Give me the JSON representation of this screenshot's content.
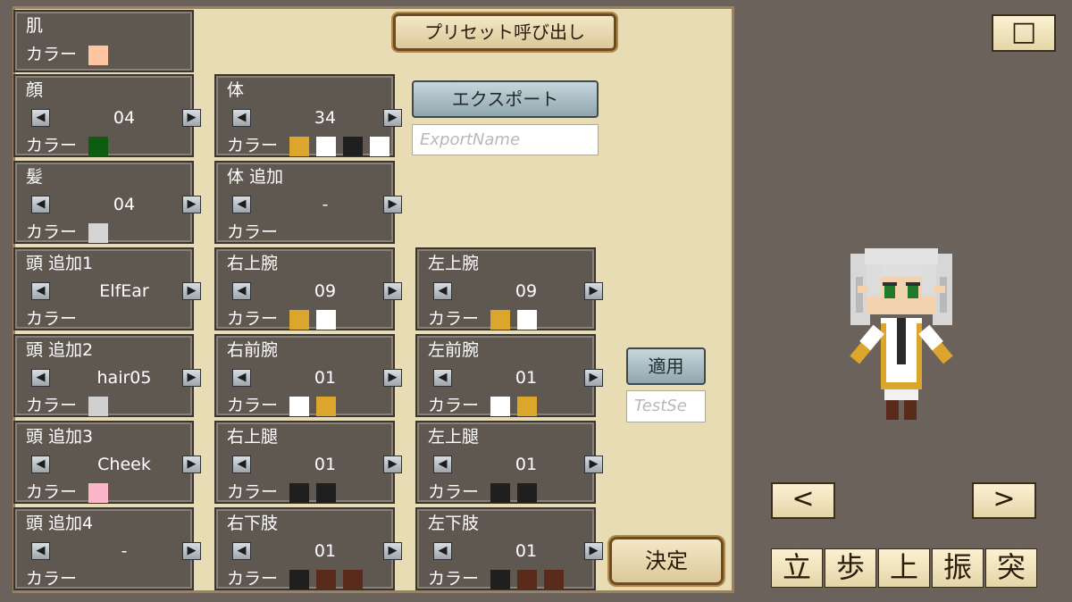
{
  "header": {
    "preset_button": "プリセット呼び出し"
  },
  "labels": {
    "color": "カラー"
  },
  "cards": {
    "skin": {
      "title": "肌",
      "colors": [
        "#fec5a2"
      ]
    },
    "face": {
      "title": "顔",
      "value": "04",
      "colors": [
        "#0c5d10"
      ]
    },
    "hair": {
      "title": "髪",
      "value": "04",
      "colors": [
        "#d4d4d4"
      ]
    },
    "head_extra1": {
      "title": "頭 追加1",
      "value": "ElfEar",
      "colors": []
    },
    "head_extra2": {
      "title": "頭 追加2",
      "value": "hair05",
      "colors": [
        "#d0d0d0"
      ]
    },
    "head_extra3": {
      "title": "頭 追加3",
      "value": "Cheek",
      "colors": [
        "#fbb7c9"
      ]
    },
    "head_extra4": {
      "title": "頭 追加4",
      "value": "-",
      "colors": []
    },
    "body": {
      "title": "体",
      "value": "34",
      "colors": [
        "#dca62c",
        "#ffffff",
        "#1f1f1f",
        "#ffffff"
      ]
    },
    "body_extra": {
      "title": "体 追加",
      "value": "-",
      "colors": []
    },
    "r_upper_arm": {
      "title": "右上腕",
      "value": "09",
      "colors": [
        "#dca62c",
        "#ffffff"
      ]
    },
    "r_forearm": {
      "title": "右前腕",
      "value": "01",
      "colors": [
        "#ffffff",
        "#dca62c"
      ]
    },
    "r_thigh": {
      "title": "右上腿",
      "value": "01",
      "colors": [
        "#1f1f1f",
        "#1f1f1f"
      ]
    },
    "r_lower_leg": {
      "title": "右下肢",
      "value": "01",
      "colors": [
        "#1f1f1f",
        "#5a2a1a",
        "#5a2a1a"
      ]
    },
    "l_upper_arm": {
      "title": "左上腕",
      "value": "09",
      "colors": [
        "#dca62c",
        "#ffffff"
      ]
    },
    "l_forearm": {
      "title": "左前腕",
      "value": "01",
      "colors": [
        "#ffffff",
        "#dca62c"
      ]
    },
    "l_thigh": {
      "title": "左上腿",
      "value": "01",
      "colors": [
        "#1f1f1f",
        "#1f1f1f"
      ]
    },
    "l_lower_leg": {
      "title": "左下肢",
      "value": "01",
      "colors": [
        "#1f1f1f",
        "#5a2a1a",
        "#5a2a1a"
      ]
    }
  },
  "export": {
    "button": "エクスポート",
    "placeholder": "ExportName"
  },
  "apply": {
    "button": "適用",
    "placeholder": "TestSe"
  },
  "confirm_button": "決定",
  "window_toggle_icon": "□",
  "nav": {
    "prev": "<",
    "next": ">"
  },
  "poses": [
    "立",
    "歩",
    "上",
    "振",
    "突"
  ],
  "colors": {
    "panel": "#e8dcb5",
    "card": "#5f5851",
    "background": "#6b625b"
  }
}
